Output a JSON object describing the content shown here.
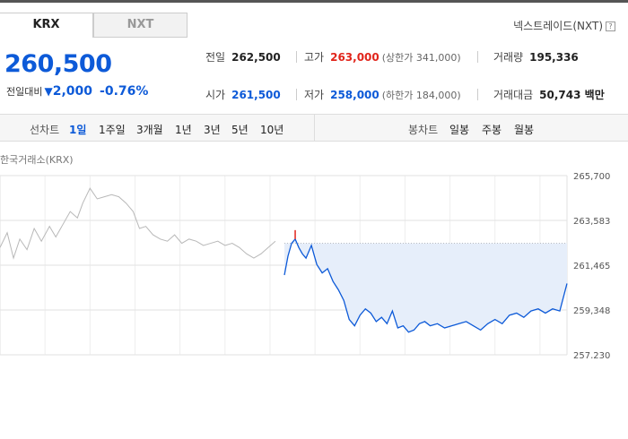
{
  "tabs": [
    {
      "label": "KRX",
      "active": true
    },
    {
      "label": "NXT",
      "active": false
    }
  ],
  "nxt_link": {
    "label": "넥스트레이드(NXT)",
    "help": "?"
  },
  "quote": {
    "price": "260,500",
    "change_label": "전일대비",
    "change_amount": "2,000",
    "change_direction": "down",
    "change_percent": "-0.76%"
  },
  "stats": {
    "prev_close": {
      "label": "전일",
      "value": "262,500"
    },
    "high": {
      "label": "고가",
      "value": "263,000",
      "sub": "(상한가 341,000)"
    },
    "volume": {
      "label": "거래량",
      "value": "195,336"
    },
    "open": {
      "label": "시가",
      "value": "261,500"
    },
    "low": {
      "label": "저가",
      "value": "258,000",
      "sub": "(하한가 184,000)"
    },
    "turnover": {
      "label": "거래대금",
      "value": "50,743 백만"
    }
  },
  "chart_bar": {
    "line_label": "선차트",
    "line_periods": [
      "1일",
      "1주일",
      "3개월",
      "1년",
      "3년",
      "5년",
      "10년"
    ],
    "active_period": "1일",
    "candle_label": "봉차트",
    "candle_periods": [
      "일봉",
      "주봉",
      "월봉"
    ]
  },
  "exchange_label": "한국거래소(KRX)",
  "colors": {
    "accent_blue": "#0d5ad8",
    "red": "#e1251b",
    "prev_day_line": "#b8b8b8",
    "fill": "#e6eefa"
  },
  "chart_data": {
    "type": "line",
    "title": "",
    "xlabel": "",
    "ylabel": "",
    "y_ticks": [
      "265,700",
      "263,583",
      "261,465",
      "259,348",
      "257,230"
    ],
    "ylim": [
      257230,
      265700
    ],
    "reference_level": 262500,
    "x_range": [
      0,
      630
    ],
    "series": [
      {
        "role": "previous-day",
        "x": [
          0,
          8,
          15,
          22,
          30,
          38,
          46,
          55,
          62,
          70,
          78,
          86,
          92,
          100,
          108,
          116,
          124,
          132,
          140,
          148,
          155,
          162,
          170,
          178,
          186,
          194,
          202,
          210,
          218,
          226,
          234,
          242,
          250,
          258,
          266,
          274,
          282,
          290,
          298,
          306
        ],
        "values": [
          262300,
          263000,
          261800,
          262700,
          262200,
          263200,
          262600,
          263300,
          262800,
          263400,
          264000,
          263700,
          264400,
          265100,
          264600,
          264700,
          264800,
          264700,
          264400,
          264000,
          263200,
          263300,
          262900,
          262700,
          262600,
          262900,
          262500,
          262700,
          262600,
          262400,
          262500,
          262600,
          262400,
          262500,
          262300,
          262000,
          261800,
          262000,
          262300,
          262600
        ]
      },
      {
        "role": "today",
        "x": [
          316,
          320,
          324,
          328,
          332,
          336,
          340,
          346,
          352,
          358,
          364,
          370,
          376,
          382,
          388,
          394,
          400,
          406,
          412,
          418,
          424,
          430,
          436,
          442,
          448,
          454,
          460,
          466,
          472,
          478,
          486,
          494,
          502,
          510,
          518,
          526,
          534,
          542,
          550,
          558,
          566,
          574,
          582,
          590,
          598,
          606,
          614,
          622,
          630
        ],
        "values": [
          261000,
          261900,
          262500,
          262700,
          262300,
          262000,
          261800,
          262400,
          261500,
          261100,
          261300,
          260700,
          260300,
          259800,
          258900,
          258600,
          259100,
          259400,
          259200,
          258800,
          259000,
          258700,
          259300,
          258500,
          258600,
          258300,
          258400,
          258700,
          258800,
          258600,
          258700,
          258500,
          258600,
          258700,
          258800,
          258600,
          258400,
          258700,
          258900,
          258700,
          259100,
          259200,
          259000,
          259300,
          259400,
          259200,
          259400,
          259300,
          260600
        ]
      }
    ]
  }
}
